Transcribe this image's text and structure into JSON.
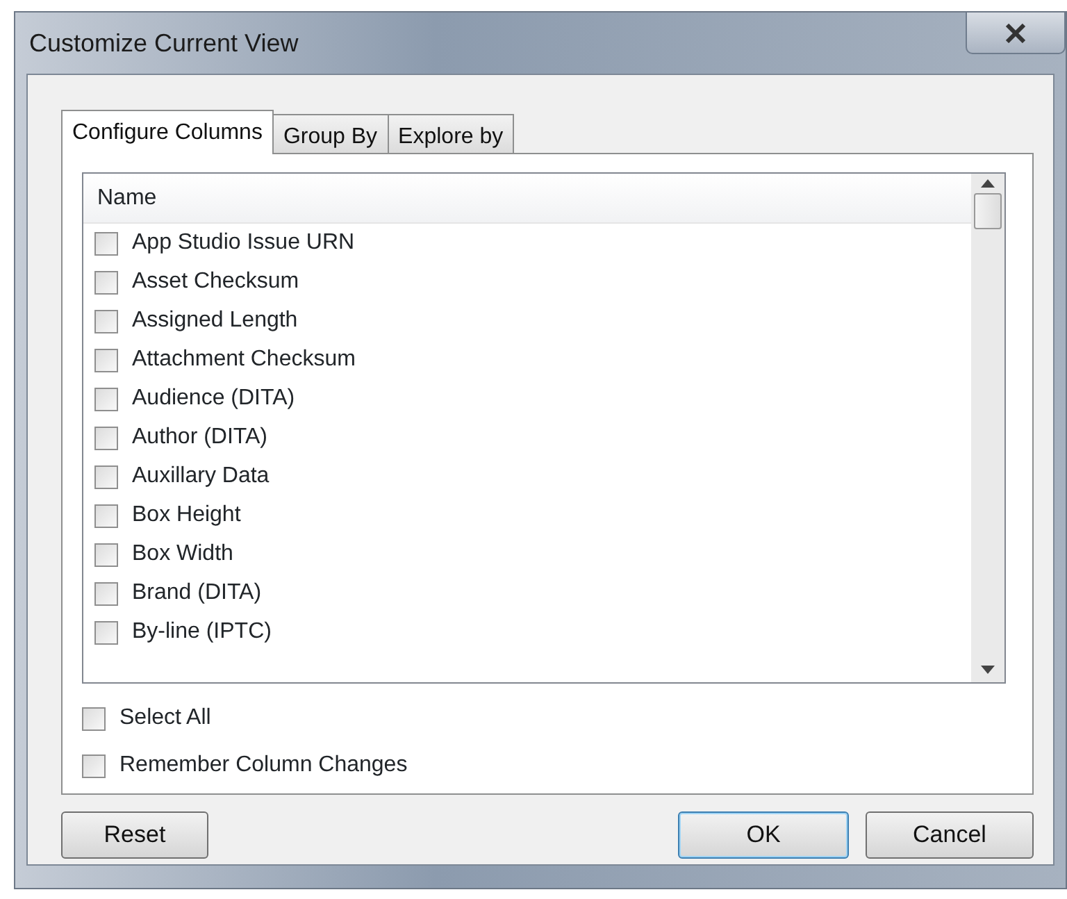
{
  "window": {
    "title": "Customize Current View"
  },
  "tabs": [
    {
      "label": "Configure Columns",
      "selected": true
    },
    {
      "label": "Group By",
      "selected": false
    },
    {
      "label": "Explore by",
      "selected": false
    }
  ],
  "list": {
    "header": "Name",
    "items": [
      {
        "label": "App Studio Issue URN",
        "checked": false
      },
      {
        "label": "Asset Checksum",
        "checked": false
      },
      {
        "label": "Assigned Length",
        "checked": false
      },
      {
        "label": "Attachment Checksum",
        "checked": false
      },
      {
        "label": "Audience (DITA)",
        "checked": false
      },
      {
        "label": "Author (DITA)",
        "checked": false
      },
      {
        "label": "Auxillary Data",
        "checked": false
      },
      {
        "label": "Box Height",
        "checked": false
      },
      {
        "label": "Box Width",
        "checked": false
      },
      {
        "label": "Brand (DITA)",
        "checked": false
      },
      {
        "label": "By-line (IPTC)",
        "checked": false
      }
    ]
  },
  "options": [
    {
      "label": "Select All",
      "checked": false
    },
    {
      "label": "Remember Column Changes",
      "checked": false
    }
  ],
  "buttons": [
    {
      "label": "Reset",
      "default": false
    },
    {
      "label": "OK",
      "default": true
    },
    {
      "label": "Cancel",
      "default": false
    }
  ]
}
